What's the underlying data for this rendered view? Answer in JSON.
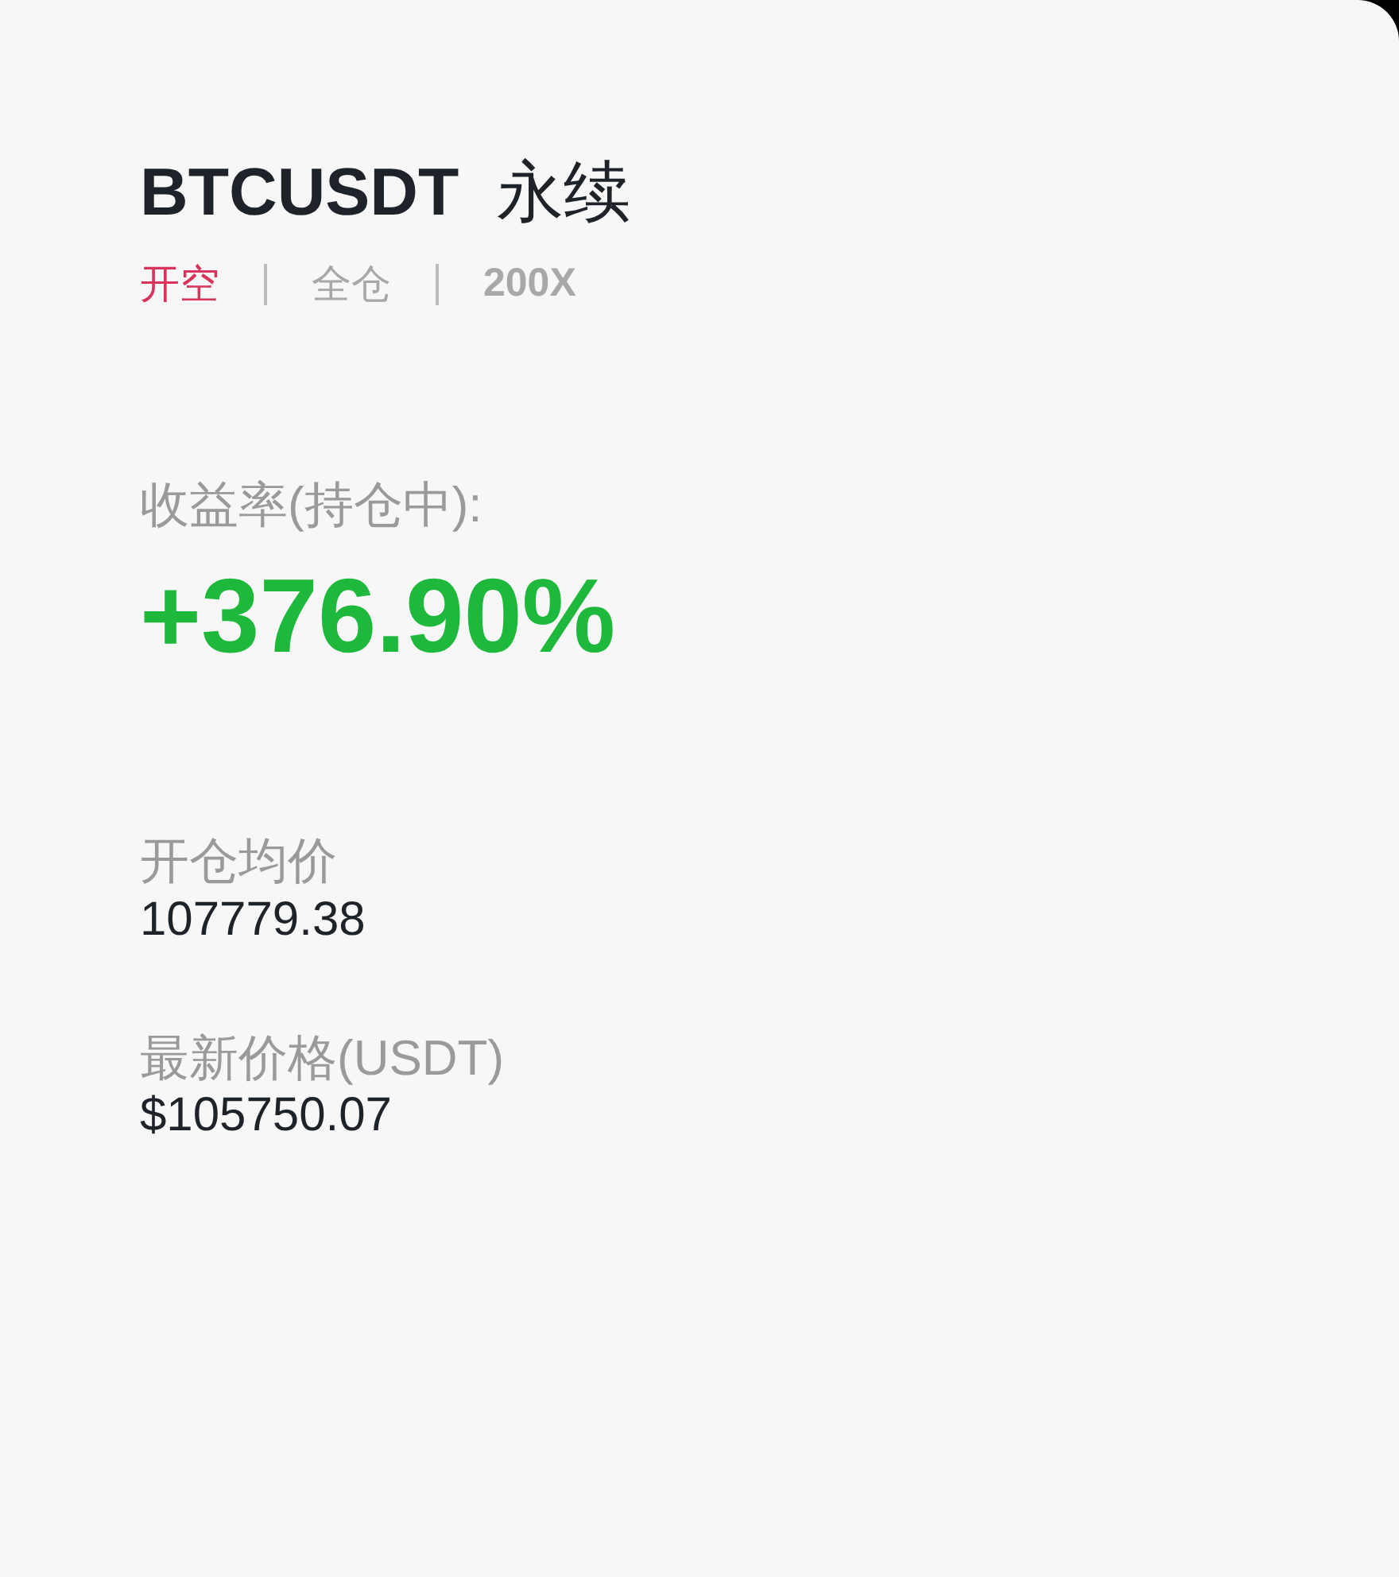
{
  "header": {
    "symbol": "BTCUSDT",
    "contract": "永续"
  },
  "tags": [
    {
      "label": "开空",
      "kind": "short"
    },
    {
      "label": "全仓",
      "kind": "plain"
    },
    {
      "label": "200X",
      "kind": "strong"
    }
  ],
  "roi": {
    "label": "收益率(持仓中):",
    "value": "+376.90%"
  },
  "stats": [
    {
      "label": "开仓均价",
      "value": "107779.38"
    },
    {
      "label": "最新价格(USDT)",
      "value": "$105750.07"
    }
  ]
}
